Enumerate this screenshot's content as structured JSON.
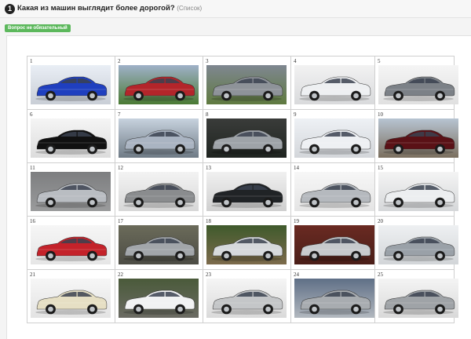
{
  "question": {
    "number": "1",
    "title": "Какая из машин выглядит более дорогой?",
    "type": "(Список)",
    "badge": "Вопрос не обязательный"
  },
  "cars": [
    {
      "label": "1",
      "body": "#1f3fbf",
      "bg_top": "#e9eef5",
      "bg_bottom": "#c9ced6"
    },
    {
      "label": "2",
      "body": "#b3252a",
      "bg_top": "#9fb1c8",
      "bg_bottom": "#4a7a33"
    },
    {
      "label": "3",
      "body": "#8e9399",
      "bg_top": "#7f8791",
      "bg_bottom": "#5f7a3f"
    },
    {
      "label": "4",
      "body": "#eef0f2",
      "bg_top": "#f2f2f2",
      "bg_bottom": "#d9dadc"
    },
    {
      "label": "5",
      "body": "#7c8187",
      "bg_top": "#f5f5f5",
      "bg_bottom": "#e0e0e0"
    },
    {
      "label": "6",
      "body": "#111111",
      "bg_top": "#f5f5f5",
      "bg_bottom": "#dcdcdc"
    },
    {
      "label": "7",
      "body": "#aab4c2",
      "bg_top": "#c7d2de",
      "bg_bottom": "#6f7b86"
    },
    {
      "label": "8",
      "body": "#9ea3a8",
      "bg_top": "#3a3c3a",
      "bg_bottom": "#1f2420"
    },
    {
      "label": "9",
      "body": "#eef0f3",
      "bg_top": "#eef1f5",
      "bg_bottom": "#d3d6da"
    },
    {
      "label": "10",
      "body": "#5a1116",
      "bg_top": "#b7c4d2",
      "bg_bottom": "#7b6f5e"
    },
    {
      "label": "11",
      "body": "#b9bdc2",
      "bg_top": "#7d7e80",
      "bg_bottom": "#9a9b9c"
    },
    {
      "label": "12",
      "body": "#8a8c8e",
      "bg_top": "#f3f3f3",
      "bg_bottom": "#d7d7d7"
    },
    {
      "label": "13",
      "body": "#202326",
      "bg_top": "#f0f0f0",
      "bg_bottom": "#cfcfcf"
    },
    {
      "label": "14",
      "body": "#b5b9be",
      "bg_top": "#f7f7f7",
      "bg_bottom": "#e4e4e4"
    },
    {
      "label": "15",
      "body": "#eceef0",
      "bg_top": "#f4f4f4",
      "bg_bottom": "#d5d7d9"
    },
    {
      "label": "16",
      "body": "#c4222a",
      "bg_top": "#f6f6f6",
      "bg_bottom": "#e6e6e6"
    },
    {
      "label": "17",
      "body": "#a2a6aa",
      "bg_top": "#6b6b5a",
      "bg_bottom": "#4c4c44"
    },
    {
      "label": "18",
      "body": "#d6d9dc",
      "bg_top": "#3f5a2c",
      "bg_bottom": "#7c6a4b"
    },
    {
      "label": "19",
      "body": "#c7cacd",
      "bg_top": "#6a2a22",
      "bg_bottom": "#4a1e18"
    },
    {
      "label": "20",
      "body": "#9aa1a8",
      "bg_top": "#eef0f2",
      "bg_bottom": "#d2d5d8"
    },
    {
      "label": "21",
      "body": "#e6dfc4",
      "bg_top": "#f6f6f6",
      "bg_bottom": "#e3e3e3"
    },
    {
      "label": "22",
      "body": "#f1f2f3",
      "bg_top": "#4a5a3a",
      "bg_bottom": "#6b6b63"
    },
    {
      "label": "23",
      "body": "#c4c6c8",
      "bg_top": "#f5f5f5",
      "bg_bottom": "#dadada"
    },
    {
      "label": "24",
      "body": "#a8acb0",
      "bg_top": "#5f6f86",
      "bg_bottom": "#b2b8bf"
    },
    {
      "label": "25",
      "body": "#9fa3a7",
      "bg_top": "#f4f4f4",
      "bg_bottom": "#d9d9d9"
    }
  ]
}
